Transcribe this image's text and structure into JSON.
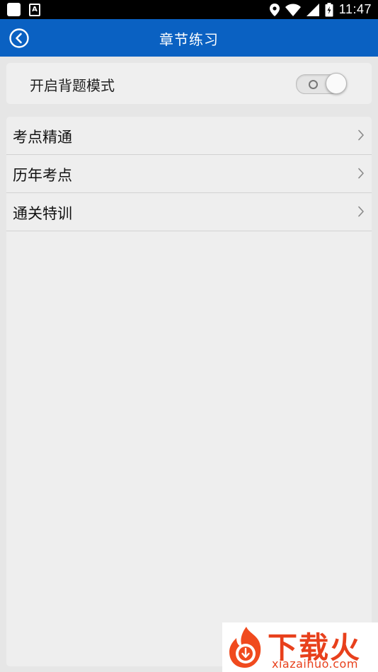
{
  "status_bar": {
    "time": "11:47",
    "left_icons": [
      "notification-square-icon",
      "font-a-icon"
    ],
    "right_icons": [
      "location-icon",
      "wifi-icon",
      "signal-icon",
      "battery-icon"
    ]
  },
  "app_bar": {
    "title": "章节练习",
    "back_icon": "back-circle-icon",
    "color": "#0a61c2"
  },
  "recite_mode": {
    "label": "开启背题模式",
    "toggle_on": false
  },
  "menu": {
    "items": [
      {
        "label": "考点精通"
      },
      {
        "label": "历年考点"
      },
      {
        "label": "通关特训"
      }
    ]
  },
  "watermark": {
    "brand": "下载火",
    "url": "xiazaihuo.com",
    "color": "#e8401c"
  }
}
